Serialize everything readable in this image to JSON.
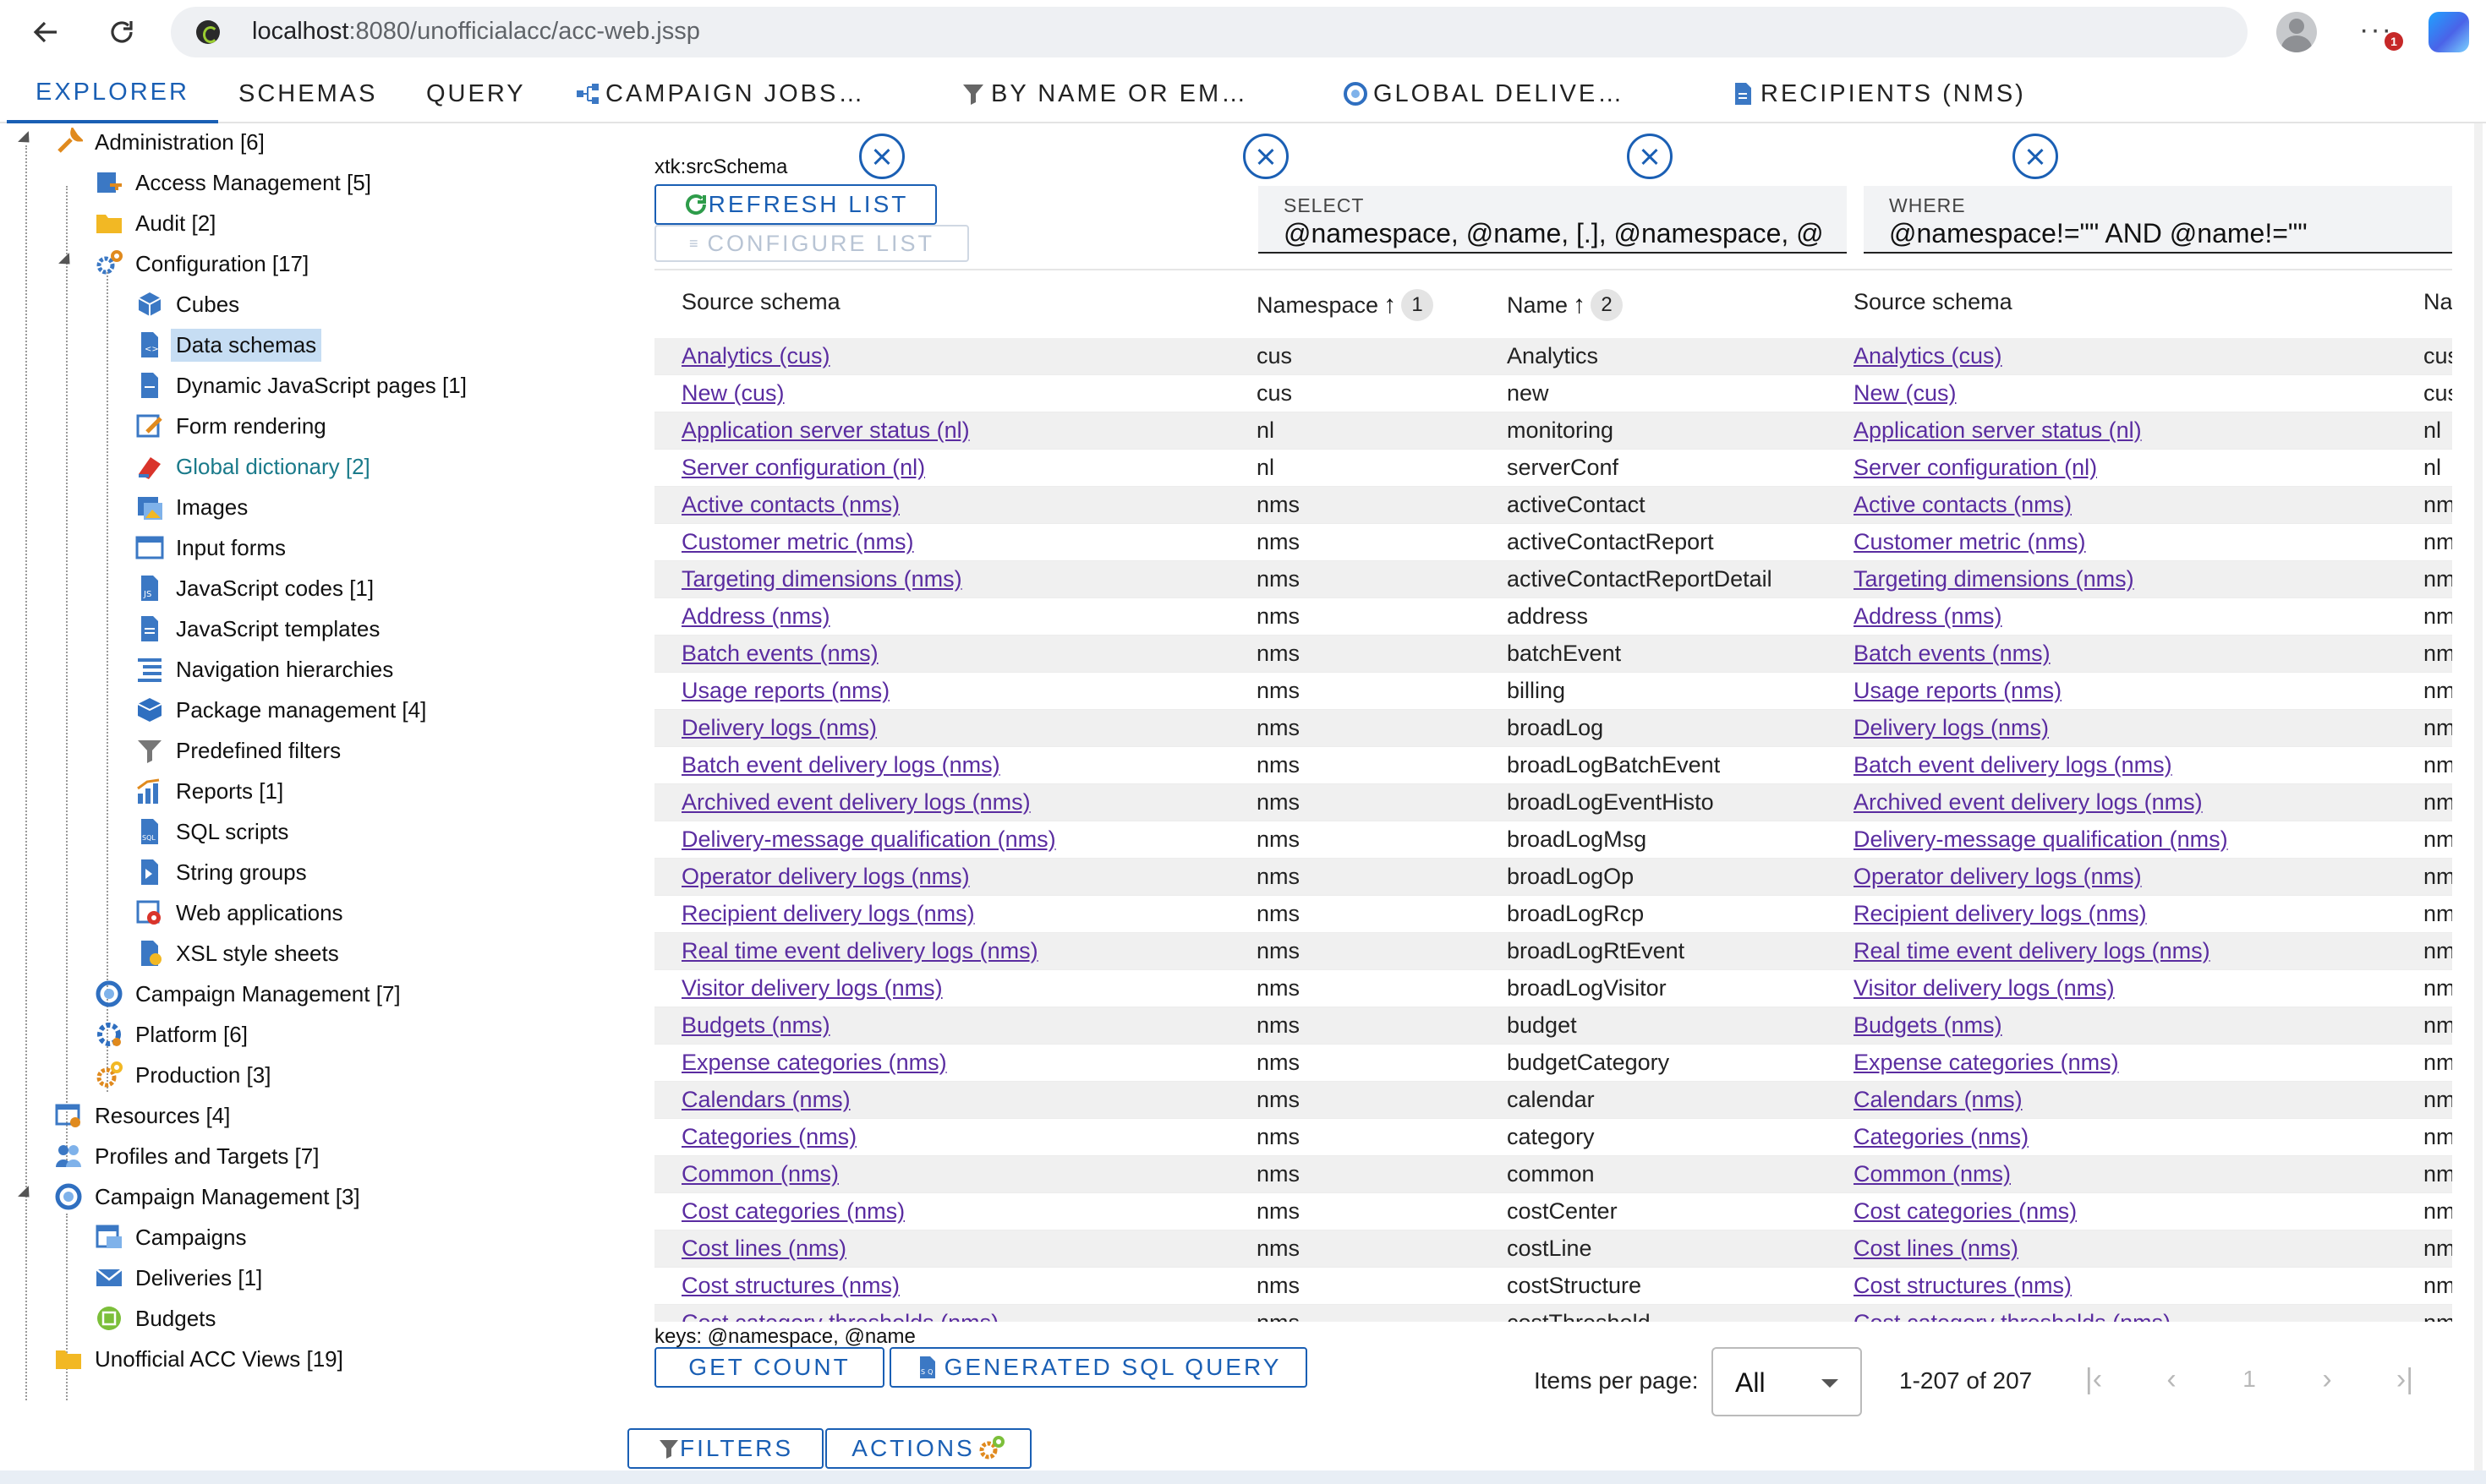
{
  "browser": {
    "url_host": "localhost",
    "url_rest": ":8080/unofficialacc/acc-web.jssp",
    "menu_badge": "1"
  },
  "tabs": [
    {
      "label": "EXPLORER"
    },
    {
      "label": "SCHEMAS"
    },
    {
      "label": "QUERY"
    },
    {
      "label": "CAMPAIGN JOBS…"
    },
    {
      "label": "BY NAME OR EM…"
    },
    {
      "label": "GLOBAL DELIVE…"
    },
    {
      "label": "RECIPIENTS (NMS)"
    }
  ],
  "tree": [
    {
      "label": "Administration [6]"
    },
    {
      "label": "Access Management [5]"
    },
    {
      "label": "Audit [2]"
    },
    {
      "label": "Configuration [17]"
    },
    {
      "label": "Cubes"
    },
    {
      "label": "Data schemas"
    },
    {
      "label": "Dynamic JavaScript pages [1]"
    },
    {
      "label": "Form rendering"
    },
    {
      "label": "Global dictionary [2]"
    },
    {
      "label": "Images"
    },
    {
      "label": "Input forms"
    },
    {
      "label": "JavaScript codes [1]"
    },
    {
      "label": "JavaScript templates"
    },
    {
      "label": "Navigation hierarchies"
    },
    {
      "label": "Package management [4]"
    },
    {
      "label": "Predefined filters"
    },
    {
      "label": "Reports [1]"
    },
    {
      "label": "SQL scripts"
    },
    {
      "label": "String groups"
    },
    {
      "label": "Web applications"
    },
    {
      "label": "XSL style sheets"
    },
    {
      "label": "Campaign Management [7]"
    },
    {
      "label": "Platform [6]"
    },
    {
      "label": "Production [3]"
    },
    {
      "label": "Resources [4]"
    },
    {
      "label": "Profiles and Targets [7]"
    },
    {
      "label": "Campaign Management [3]"
    },
    {
      "label": "Campaigns"
    },
    {
      "label": "Deliveries [1]"
    },
    {
      "label": "Budgets"
    },
    {
      "label": "Unofficial ACC Views [19]"
    }
  ],
  "main": {
    "schema": "xtk:srcSchema",
    "refresh_label": "REFRESH LIST",
    "configure_label": "CONFIGURE LIST",
    "select_label": "SELECT",
    "select_value": "@namespace, @name, [.], @namespace, @",
    "where_label": "WHERE",
    "where_value": "@namespace!=\"\" AND @name!=\"\"",
    "columns": {
      "source_schema": "Source schema",
      "namespace": "Namespace",
      "namespace_sort": "1",
      "name": "Name",
      "name_sort": "2",
      "source_schema2": "Source schema",
      "na": "Na"
    },
    "rows": [
      [
        "Analytics (cus)",
        "cus",
        "Analytics",
        "Analytics (cus)",
        "cus"
      ],
      [
        "New (cus)",
        "cus",
        "new",
        "New (cus)",
        "cus"
      ],
      [
        "Application server status (nl)",
        "nl",
        "monitoring",
        "Application server status (nl)",
        "nl"
      ],
      [
        "Server configuration (nl)",
        "nl",
        "serverConf",
        "Server configuration (nl)",
        "nl"
      ],
      [
        "Active contacts (nms)",
        "nms",
        "activeContact",
        "Active contacts (nms)",
        "nm"
      ],
      [
        "Customer metric (nms)",
        "nms",
        "activeContactReport",
        "Customer metric (nms)",
        "nm"
      ],
      [
        "Targeting dimensions (nms)",
        "nms",
        "activeContactReportDetail",
        "Targeting dimensions (nms)",
        "nm"
      ],
      [
        "Address (nms)",
        "nms",
        "address",
        "Address (nms)",
        "nm"
      ],
      [
        "Batch events (nms)",
        "nms",
        "batchEvent",
        "Batch events (nms)",
        "nm"
      ],
      [
        "Usage reports (nms)",
        "nms",
        "billing",
        "Usage reports (nms)",
        "nm"
      ],
      [
        "Delivery logs (nms)",
        "nms",
        "broadLog",
        "Delivery logs (nms)",
        "nm"
      ],
      [
        "Batch event delivery logs (nms)",
        "nms",
        "broadLogBatchEvent",
        "Batch event delivery logs (nms)",
        "nm"
      ],
      [
        "Archived event delivery logs (nms)",
        "nms",
        "broadLogEventHisto",
        "Archived event delivery logs (nms)",
        "nm"
      ],
      [
        "Delivery-message qualification (nms)",
        "nms",
        "broadLogMsg",
        "Delivery-message qualification (nms)",
        "nm"
      ],
      [
        "Operator delivery logs (nms)",
        "nms",
        "broadLogOp",
        "Operator delivery logs (nms)",
        "nm"
      ],
      [
        "Recipient delivery logs (nms)",
        "nms",
        "broadLogRcp",
        "Recipient delivery logs (nms)",
        "nm"
      ],
      [
        "Real time event delivery logs (nms)",
        "nms",
        "broadLogRtEvent",
        "Real time event delivery logs (nms)",
        "nm"
      ],
      [
        "Visitor delivery logs (nms)",
        "nms",
        "broadLogVisitor",
        "Visitor delivery logs (nms)",
        "nm"
      ],
      [
        "Budgets (nms)",
        "nms",
        "budget",
        "Budgets (nms)",
        "nm"
      ],
      [
        "Expense categories (nms)",
        "nms",
        "budgetCategory",
        "Expense categories (nms)",
        "nm"
      ],
      [
        "Calendars (nms)",
        "nms",
        "calendar",
        "Calendars (nms)",
        "nm"
      ],
      [
        "Categories (nms)",
        "nms",
        "category",
        "Categories (nms)",
        "nm"
      ],
      [
        "Common (nms)",
        "nms",
        "common",
        "Common (nms)",
        "nm"
      ],
      [
        "Cost categories (nms)",
        "nms",
        "costCenter",
        "Cost categories (nms)",
        "nm"
      ],
      [
        "Cost lines (nms)",
        "nms",
        "costLine",
        "Cost lines (nms)",
        "nm"
      ],
      [
        "Cost structures (nms)",
        "nms",
        "costStructure",
        "Cost structures (nms)",
        "nm"
      ],
      [
        "Cost category thresholds (nms)",
        "nms",
        "costThreshold",
        "Cost category thresholds (nms)",
        "nm"
      ]
    ],
    "keys": "keys: @namespace, @name",
    "get_count_label": "GET COUNT",
    "sql_label": "GENERATED SQL QUERY",
    "items_per_page_label": "Items per page:",
    "items_per_page_value": "All",
    "range": "1-207 of 207",
    "page_current": "1",
    "filters_label": "FILTERS",
    "actions_label": "ACTIONS"
  },
  "colors": {
    "accent": "#1a5fb4",
    "link": "#5a2ca0",
    "selected_bg": "#c6ddf3",
    "accent_text": "#1a7a8a"
  },
  "icons": {
    "tree": [
      "wrench-icon",
      "user-key-icon",
      "folder-icon",
      "gears-icon",
      "cube-icon",
      "schema-file-icon",
      "js-page-icon",
      "form-edit-icon",
      "dictionary-icon",
      "images-icon",
      "window-icon",
      "js-file-icon",
      "js-template-icon",
      "hierarchy-icon",
      "package-icon",
      "filter-icon",
      "chart-icon",
      "sql-file-icon",
      "string-file-icon",
      "web-app-icon",
      "xsl-icon",
      "campaign-icon",
      "platform-icon",
      "production-icon",
      "resources-icon",
      "profiles-icon",
      "campaign-icon",
      "campaigns-icon",
      "deliveries-icon",
      "budgets-icon",
      "folder-icon"
    ]
  }
}
